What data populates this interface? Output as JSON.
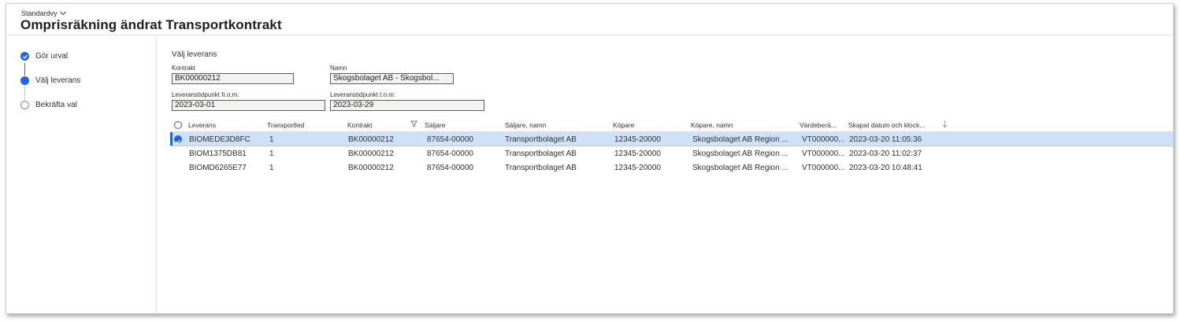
{
  "header": {
    "view_name": "Standardvy",
    "title": "Omprisräkning ändrat Transportkontrakt"
  },
  "wizard": {
    "steps": [
      {
        "label": "Gör urval",
        "state": "done"
      },
      {
        "label": "Välj leverans",
        "state": "current"
      },
      {
        "label": "Bekräfta val",
        "state": "todo"
      }
    ]
  },
  "form": {
    "section_title": "Välj leverans",
    "kontrakt": {
      "label": "Kontrakt",
      "value": "BK00000212"
    },
    "namn": {
      "label": "Namn",
      "value": "Skogsbolaget AB - Skogsbol..."
    },
    "from_date": {
      "label": "Leveranstidpunkt fr.o.m.",
      "value": "2023-03-01"
    },
    "to_date": {
      "label": "Leveranstidpunkt t.o.m.",
      "value": "2023-03-29"
    }
  },
  "grid": {
    "columns": [
      "Leverans",
      "Transportled",
      "Kontrakt",
      "Säljare",
      "Säljare, namn",
      "Köpare",
      "Köpare, namn",
      "Värdeberä...",
      "Skapat datum och klock..."
    ],
    "rows": [
      [
        "BIOMEDE3D8FC",
        "1",
        "BK00000212",
        "87654-00000",
        "Transportbolaget AB",
        "12345-20000",
        "Skogsbolaget AB Region ...",
        "VT000000...",
        "2023-03-20 11:05:36"
      ],
      [
        "BIOM1375DB81",
        "1",
        "BK00000212",
        "87654-00000",
        "Transportbolaget AB",
        "12345-20000",
        "Skogsbolaget AB Region ...",
        "VT000000...",
        "2023-03-20 11:02:37"
      ],
      [
        "BIOMD6265E77",
        "1",
        "BK00000212",
        "87654-00000",
        "Transportbolaget AB",
        "12345-20000",
        "Skogsbolaget AB Region ...",
        "VT000000...",
        "2023-03-20 10:48:41"
      ]
    ],
    "selected_row": 0,
    "filtered_column": "Kontrakt",
    "sorted_column": "Skapat datum och klock...",
    "sort_direction": "descending"
  },
  "colors": {
    "accent": "#2266e3",
    "selected_row": "#cfe0f7"
  }
}
